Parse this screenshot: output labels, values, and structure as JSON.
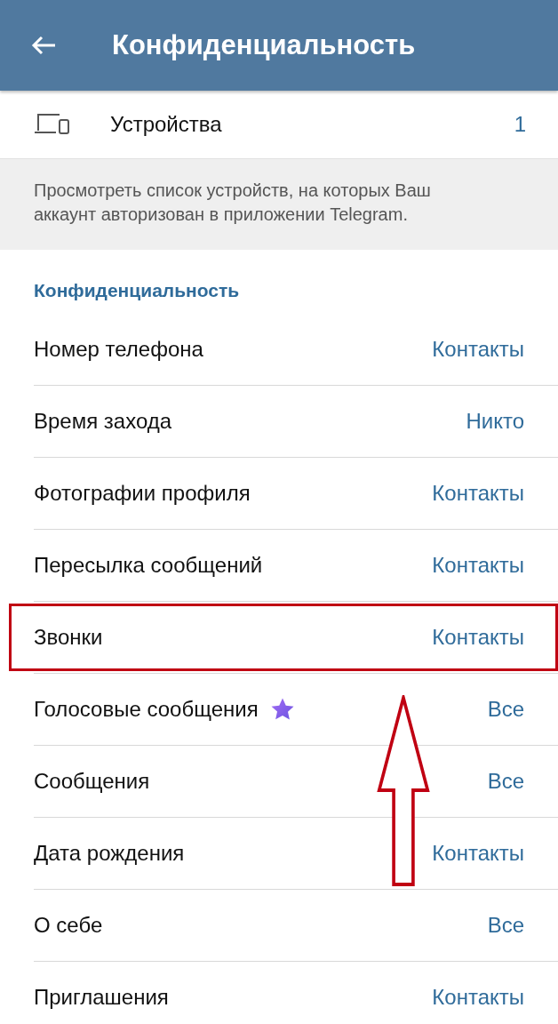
{
  "header": {
    "title": "Конфиденциальность"
  },
  "devices": {
    "label": "Устройства",
    "count": "1"
  },
  "devices_hint": "Просмотреть список устройств, на которых Ваш аккаунт авторизован в приложении Telegram.",
  "section": {
    "title": "Конфиденциальность",
    "rows": [
      {
        "label": "Номер телефона",
        "value": "Контакты",
        "premium": false,
        "highlighted": false
      },
      {
        "label": "Время захода",
        "value": "Никто",
        "premium": false,
        "highlighted": false
      },
      {
        "label": "Фотографии профиля",
        "value": "Контакты",
        "premium": false,
        "highlighted": false
      },
      {
        "label": "Пересылка сообщений",
        "value": "Контакты",
        "premium": false,
        "highlighted": false
      },
      {
        "label": "Звонки",
        "value": "Контакты",
        "premium": false,
        "highlighted": true
      },
      {
        "label": "Голосовые сообщения",
        "value": "Все",
        "premium": true,
        "highlighted": false
      },
      {
        "label": "Сообщения",
        "value": "Все",
        "premium": false,
        "highlighted": false
      },
      {
        "label": "Дата рождения",
        "value": "Контакты",
        "premium": false,
        "highlighted": false
      },
      {
        "label": "О себе",
        "value": "Все",
        "premium": false,
        "highlighted": false
      },
      {
        "label": "Приглашения",
        "value": "Контакты",
        "premium": false,
        "highlighted": false
      }
    ]
  }
}
